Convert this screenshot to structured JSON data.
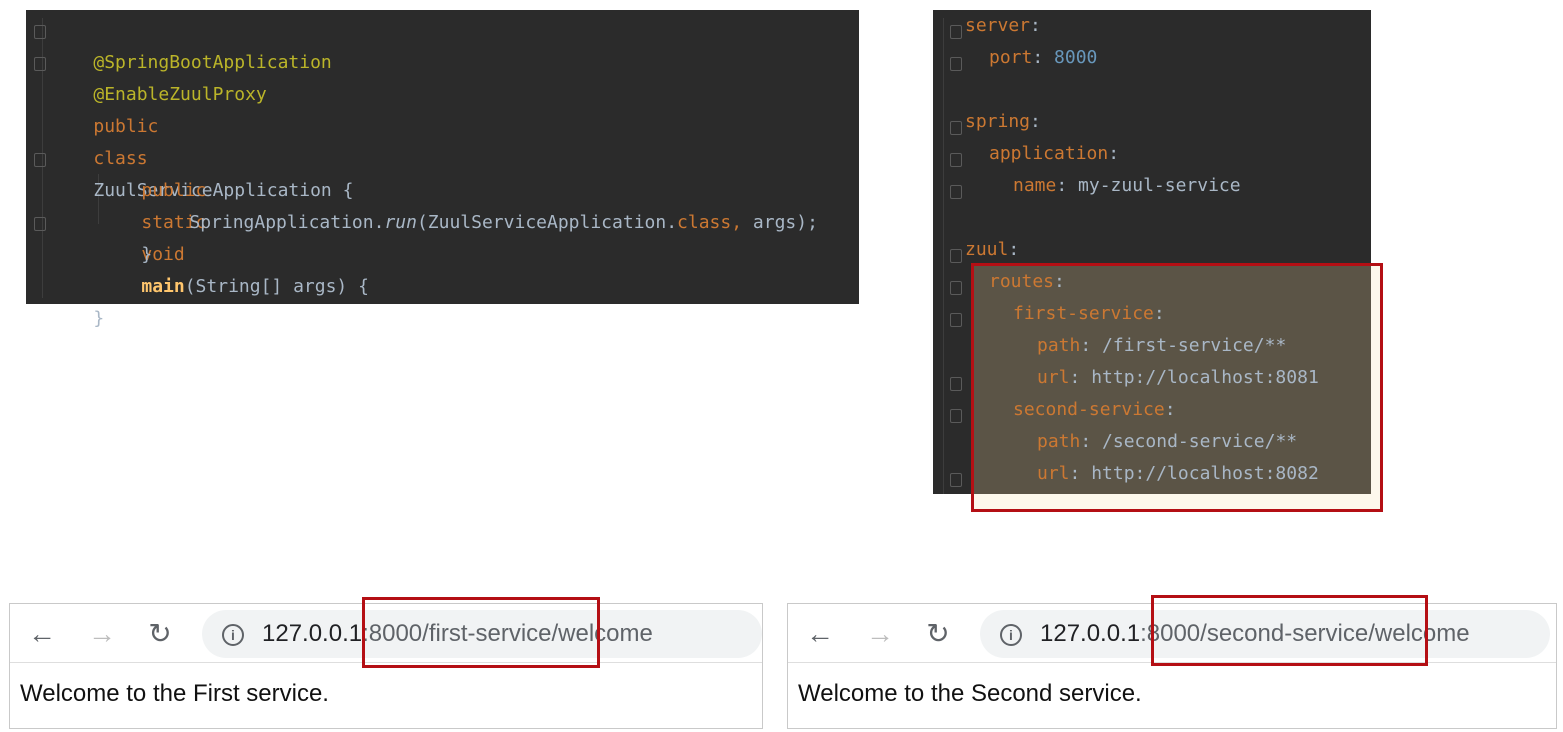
{
  "java_code": {
    "line1": "@SpringBootApplication",
    "line2": "@EnableZuulProxy",
    "line3_kw1": "public",
    "line3_kw2": "class",
    "line3_name": "ZuulServiceApplication {",
    "line5_kw1": "public",
    "line5_kw2": "static",
    "line5_kw3": "void",
    "line5_fn": "main",
    "line5_rest": "(String[] args) {",
    "line6_a": "SpringApplication.",
    "line6_run": "run",
    "line6_b": "(ZuulServiceApplication.",
    "line6_class": "class",
    "line6_comma": ",",
    "line6_c": " args);",
    "line7": "}",
    "line9": "}"
  },
  "yaml_code": {
    "server_key": "server",
    "port_key": "port",
    "port_val": "8000",
    "spring_key": "spring",
    "application_key": "application",
    "name_key": "name",
    "name_val": "my-zuul-service",
    "zuul_key": "zuul",
    "routes_key": "routes",
    "first_service_key": "first-service",
    "first_path_key": "path",
    "first_path_val": "/first-service/**",
    "first_url_key": "url",
    "first_url_val": "http://localhost:8081",
    "second_service_key": "second-service",
    "second_path_key": "path",
    "second_path_val": "/second-service/**",
    "second_url_key": "url",
    "second_url_val": "http://localhost:8082",
    "colon": ":"
  },
  "browser1": {
    "url_host": "127.0.0.1",
    "url_path": ":8000/first-service/welcome",
    "page_text": "Welcome to the First service."
  },
  "browser2": {
    "url_host": "127.0.0.1",
    "url_path": ":8000/second-service/welcome",
    "page_text": "Welcome to the Second service."
  },
  "icons": {
    "back": "←",
    "forward": "→",
    "reload": "↻",
    "info": "i"
  },
  "colors": {
    "editor_bg": "#2b2b2b",
    "keyword": "#cc7832",
    "annotation": "#bbb529",
    "highlight_border": "#b40f14"
  }
}
